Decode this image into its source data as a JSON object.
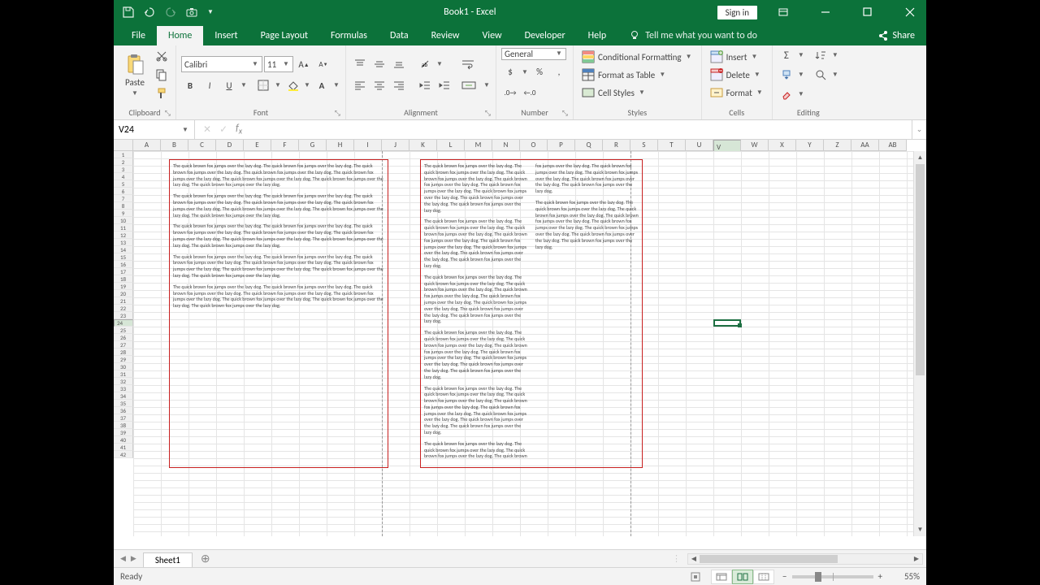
{
  "title": "Book1 - Excel",
  "qat": {
    "save": "save-icon",
    "undo": "undo-icon",
    "redo": "redo-icon",
    "camera": "camera-icon"
  },
  "signin": "Sign in",
  "tabs": [
    "File",
    "Home",
    "Insert",
    "Page Layout",
    "Formulas",
    "Data",
    "Review",
    "View",
    "Developer",
    "Help"
  ],
  "active_tab": "Home",
  "tell_me": "Tell me what you want to do",
  "share": "Share",
  "ribbon": {
    "clipboard": {
      "label": "Clipboard",
      "paste": "Paste"
    },
    "font": {
      "label": "Font",
      "name": "Calibri",
      "size": "11"
    },
    "alignment": {
      "label": "Alignment"
    },
    "number": {
      "label": "Number",
      "format": "General"
    },
    "styles": {
      "label": "Styles",
      "cond": "Conditional Formatting",
      "table": "Format as Table",
      "cell": "Cell Styles"
    },
    "cells": {
      "label": "Cells",
      "insert": "Insert",
      "delete": "Delete",
      "format": "Format"
    },
    "editing": {
      "label": "Editing"
    }
  },
  "namebox": "V24",
  "formula": "",
  "cols": [
    "A",
    "B",
    "C",
    "D",
    "E",
    "F",
    "G",
    "H",
    "I",
    "J",
    "K",
    "L",
    "M",
    "N",
    "O",
    "P",
    "Q",
    "R",
    "S",
    "T",
    "U",
    "V",
    "W",
    "X",
    "Y",
    "Z",
    "AA",
    "AB"
  ],
  "rows": 42,
  "selected_col_index": 21,
  "selected_row": 24,
  "lorem": "The quick brown fox jumps over the lazy dog.  The quick brown fox jumps over the lazy dog.  The quick brown fox jumps over the lazy dog.  The quick brown fox jumps over the lazy dog.  The quick brown fox jumps over the lazy dog.  The quick brown fox jumps over the lazy dog.  The quick brown fox jumps over the lazy dog.  The quick brown fox jumps over the lazy dog.",
  "sheet_tab": "Sheet1",
  "status": "Ready",
  "zoom": "55%"
}
